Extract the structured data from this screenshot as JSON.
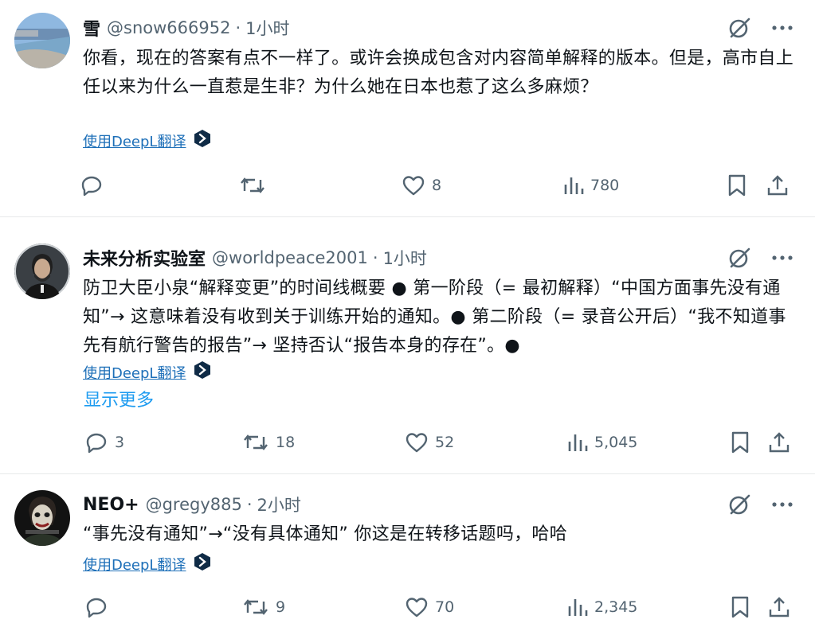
{
  "tweets": [
    {
      "name": "雪",
      "handle": "@snow666952",
      "time": "1小时",
      "text": "你看，现在的答案有点不一样了。或许会换成包含对内容简单解释的版本。但是，高市自上任以来为什么一直惹是生非？为什么她在日本也惹了这么多麻烦？",
      "translate_label": "使用DeepL翻译",
      "show_more": "",
      "replies": "",
      "retweets": "",
      "likes": "8",
      "views": "780"
    },
    {
      "name": "未来分析实验室",
      "handle": "@worldpeace2001",
      "time": "1小时",
      "text": "防卫大臣小泉“解释变更”的时间线概要 ● 第一阶段（= 最初解释）“中国方面事先没有通知”→ 这意味着没有收到关于训练开始的通知。● 第二阶段（= 录音公开后）“我不知道事先有航行警告的报告”→ 坚持否认“报告本身的存在”。●",
      "translate_label": "使用DeepL翻译",
      "show_more": "显示更多",
      "replies": "3",
      "retweets": "18",
      "likes": "52",
      "views": "5,045"
    },
    {
      "name": "NEO+",
      "handle": "@gregy885",
      "time": "2小时",
      "text": "“事先没有通知”→“没有具体通知” 你这是在转移话题吗，哈哈",
      "translate_label": "使用DeepL翻译",
      "show_more": "",
      "replies": "",
      "retweets": "9",
      "likes": "70",
      "views": "2,345"
    }
  ],
  "separator": "·",
  "colors": {
    "text": "#0f1419",
    "secondary": "#536471",
    "link": "#1d9bf0",
    "translate_link": "#1d6fb8",
    "divider": "#e7e9ea"
  },
  "icons": [
    "grok-icon",
    "more-icon",
    "reply-icon",
    "retweet-icon",
    "like-icon",
    "views-icon",
    "bookmark-icon",
    "share-icon",
    "deepl-icon"
  ]
}
